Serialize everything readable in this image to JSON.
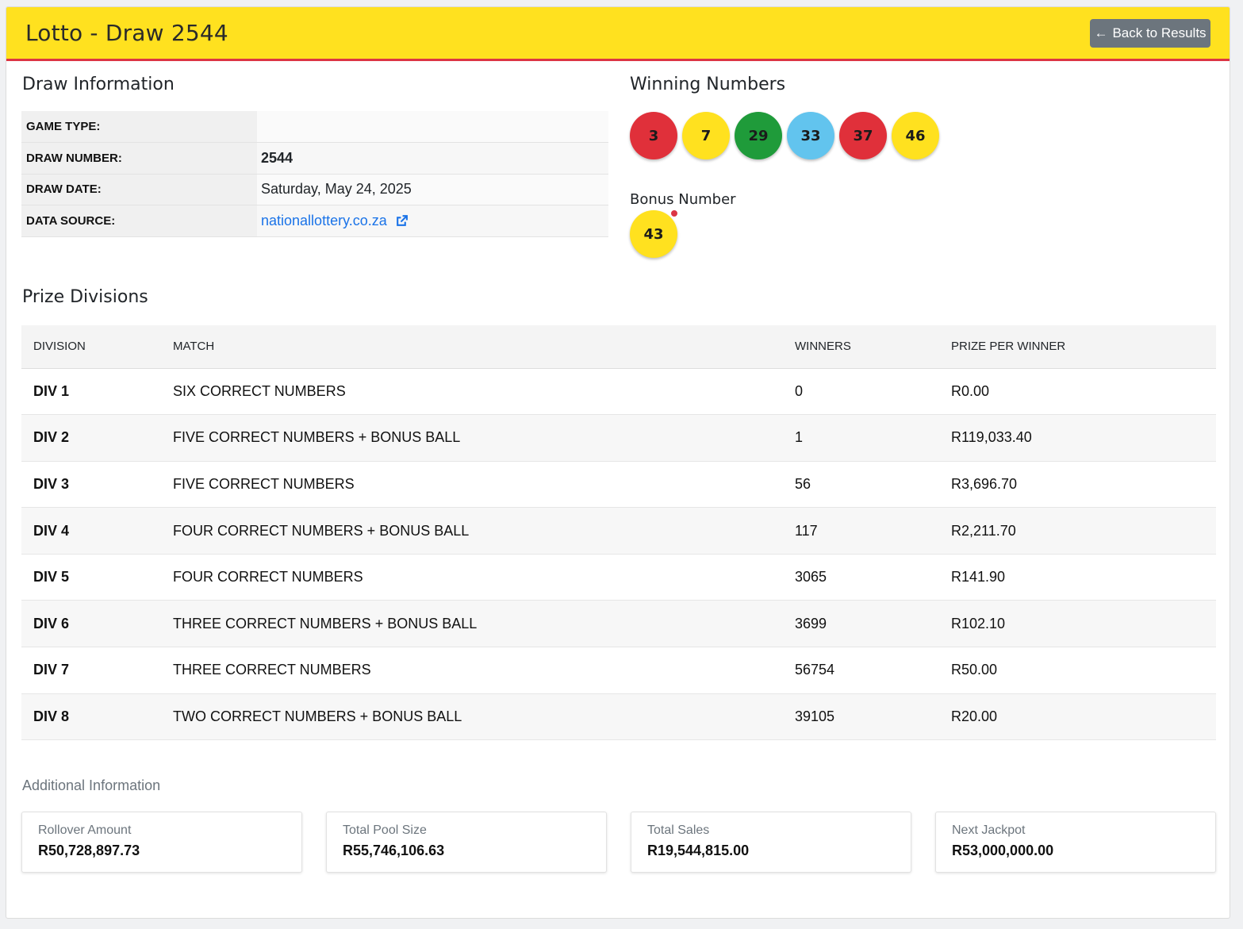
{
  "header": {
    "title": "Lotto - Draw 2544",
    "back_button": "Back to Results"
  },
  "draw_info": {
    "title": "Draw Information",
    "rows": [
      {
        "label": "GAME TYPE:",
        "value": ""
      },
      {
        "label": "DRAW NUMBER:",
        "value": "2544"
      },
      {
        "label": "DRAW DATE:",
        "value": "Saturday, May 24, 2025"
      },
      {
        "label": "DATA SOURCE:",
        "value": "nationallottery.co.za"
      }
    ]
  },
  "winning": {
    "title": "Winning Numbers",
    "balls": [
      {
        "number": "3",
        "color": "#e0303a"
      },
      {
        "number": "7",
        "color": "#ffe11f"
      },
      {
        "number": "29",
        "color": "#1f9b3a"
      },
      {
        "number": "33",
        "color": "#62c4ee"
      },
      {
        "number": "37",
        "color": "#e0303a"
      },
      {
        "number": "46",
        "color": "#ffe11f"
      }
    ],
    "bonus_label": "Bonus Number",
    "bonus": {
      "number": "43",
      "color": "#ffe11f"
    }
  },
  "prizes": {
    "title": "Prize Divisions",
    "headers": [
      "DIVISION",
      "MATCH",
      "WINNERS",
      "PRIZE PER WINNER"
    ],
    "rows": [
      [
        "DIV 1",
        "SIX CORRECT NUMBERS",
        "0",
        "R0.00"
      ],
      [
        "DIV 2",
        "FIVE CORRECT NUMBERS + BONUS BALL",
        "1",
        "R119,033.40"
      ],
      [
        "DIV 3",
        "FIVE CORRECT NUMBERS",
        "56",
        "R3,696.70"
      ],
      [
        "DIV 4",
        "FOUR CORRECT NUMBERS + BONUS BALL",
        "117",
        "R2,211.70"
      ],
      [
        "DIV 5",
        "FOUR CORRECT NUMBERS",
        "3065",
        "R141.90"
      ],
      [
        "DIV 6",
        "THREE CORRECT NUMBERS + BONUS BALL",
        "3699",
        "R102.10"
      ],
      [
        "DIV 7",
        "THREE CORRECT NUMBERS",
        "56754",
        "R50.00"
      ],
      [
        "DIV 8",
        "TWO CORRECT NUMBERS + BONUS BALL",
        "39105",
        "R20.00"
      ]
    ]
  },
  "additional": {
    "title": "Additional Information",
    "cards": [
      {
        "label": "Rollover Amount",
        "value": "R50,728,897.73"
      },
      {
        "label": "Total Pool Size",
        "value": "R55,746,106.63"
      },
      {
        "label": "Total Sales",
        "value": "R19,544,815.00"
      },
      {
        "label": "Next Jackpot",
        "value": "R53,000,000.00"
      }
    ]
  }
}
